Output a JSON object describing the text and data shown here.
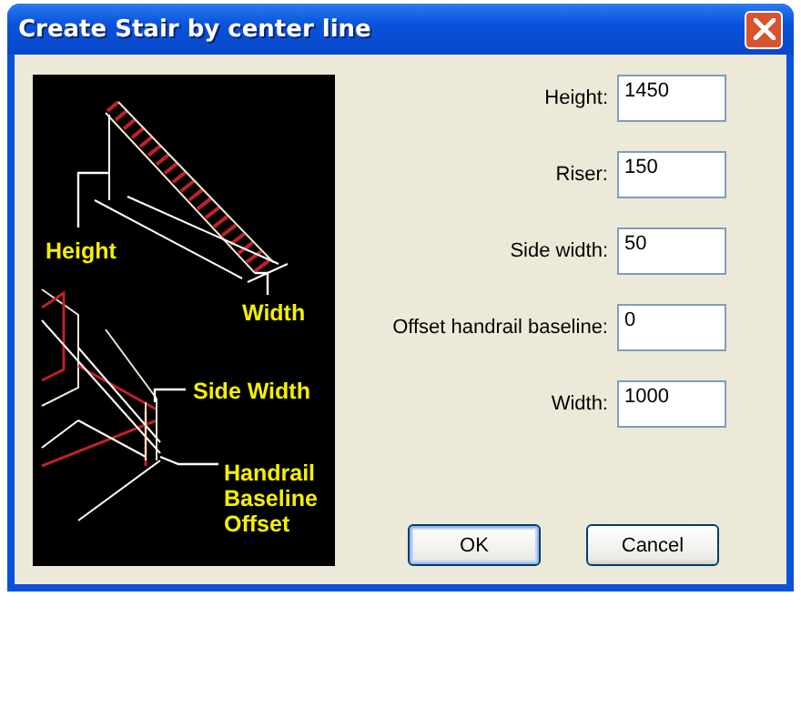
{
  "window": {
    "title": "Create Stair by center line"
  },
  "diagram": {
    "labels": [
      {
        "lines": [
          "Height"
        ]
      },
      {
        "lines": [
          "Width"
        ]
      },
      {
        "lines": [
          "Side Width"
        ]
      },
      {
        "lines": [
          "Handrail",
          "Baseline",
          "Offset"
        ]
      }
    ]
  },
  "fields": [
    {
      "label": "Height:",
      "value": "1450"
    },
    {
      "label": "Riser:",
      "value": "150"
    },
    {
      "label": "Side width:",
      "value": "50"
    },
    {
      "label": "Offset handrail baseline:",
      "value": "0"
    },
    {
      "label": "Width:",
      "value": "1000"
    }
  ],
  "buttons": [
    {
      "label": "OK",
      "default": true
    },
    {
      "label": "Cancel",
      "default": false
    }
  ]
}
